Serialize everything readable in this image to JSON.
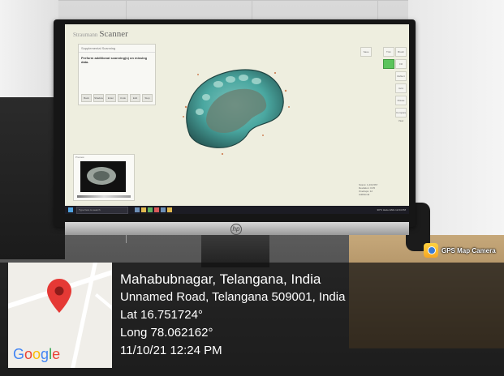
{
  "screen_app": {
    "brand": "Straumann",
    "title": "Scanner",
    "subtitle": "",
    "dialog": {
      "title": "Supplemental Scanning",
      "message": "Perform additional scanning(s) on missing data.",
      "buttons": [
        "Back",
        "Shadow",
        "Enter",
        "Undo",
        "Edit",
        "Stop"
      ]
    },
    "preview_label": "Preview",
    "right_tools": [
      "Save",
      "Trim",
      "Brush",
      "Fill",
      "Reflect",
      "Grid",
      "Rotate",
      "Compare View"
    ],
    "status_lines": [
      "Scans: 1,234,567",
      "Deviation: 0.05",
      "Overlaps: 12",
      "Additional"
    ],
    "taskbar": {
      "search_placeholder": "Type here to search",
      "tray_text": "30°C  Haze  ENG  12:24 PM"
    }
  },
  "gps_badge": {
    "label": "GPS Map Camera"
  },
  "location": {
    "city": "Mahabubnagar, Telangana, India",
    "address": "Unnamed Road, Telangana 509001, India",
    "lat": "Lat 16.751724°",
    "long": "Long 78.062162°",
    "datetime": "11/10/21 12:24 PM"
  },
  "map": {
    "logo": "Google",
    "pin_icon": "map-pin-icon",
    "pin_color": "#e53935"
  },
  "colors": {
    "scan_teal": "#4aa7a0",
    "overlay_bg": "#121212",
    "tool_green": "#5cc45c"
  }
}
